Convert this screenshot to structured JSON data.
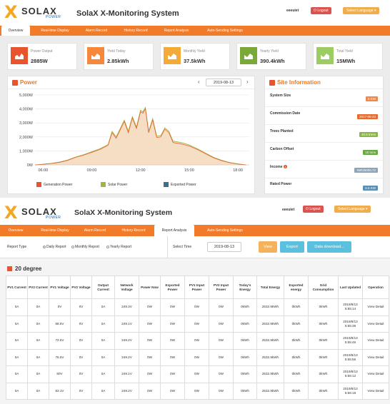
{
  "app": {
    "brand": "SOLAX",
    "brand_sub": "POWER",
    "title": "SolaX X-Monitoring System",
    "user": "eeeuiet",
    "logout_label": "Logout",
    "language_label": "Select Language"
  },
  "tabs": [
    {
      "label": "Overview"
    },
    {
      "label": "Real-time Display"
    },
    {
      "label": "Alarm Record"
    },
    {
      "label": "History Record"
    },
    {
      "label": "Report Analysis"
    },
    {
      "label": "Auto-Sending Settings"
    }
  ],
  "overview": {
    "cards": [
      {
        "label": "Power Output",
        "value": "2885W",
        "color": "#e8542d",
        "icon": "power-chart-icon"
      },
      {
        "label": "Yield Today",
        "value": "2.85kWh",
        "color": "#f5883a",
        "icon": "yield-chart-icon"
      },
      {
        "label": "Monthly Yield",
        "value": "37.5kWh",
        "color": "#f3aa38",
        "icon": "yield-chart-icon"
      },
      {
        "label": "Yearly Yield",
        "value": "390.4kWh",
        "color": "#7ba939",
        "icon": "yield-chart-icon"
      },
      {
        "label": "Total Yield",
        "value": "15MWh",
        "color": "#9ccc62",
        "icon": "yield-chart-icon"
      }
    ],
    "power_panel": {
      "title": "Power",
      "date": "2019-08-13",
      "legend": [
        {
          "label": "Generation Power",
          "color": "#e8542d"
        },
        {
          "label": "Solar Power",
          "color": "#a6b53a"
        },
        {
          "label": "Exported Power",
          "color": "#3b6f8e"
        }
      ]
    },
    "site_info": {
      "title": "Site Information",
      "rows": [
        {
          "label": "System Size",
          "value": "5 KW",
          "color": "#f0874b"
        },
        {
          "label": "Commission Date",
          "value": "2017-05-23",
          "color": "#e96a2d"
        },
        {
          "label": "Trees Planted",
          "value": "40.5 trees",
          "color": "#8ab547"
        },
        {
          "label": "Carbon Offset",
          "value": "15 tons",
          "color": "#6aa842"
        },
        {
          "label": "Income",
          "value": "INR25006.72",
          "color": "#8da3b7"
        },
        {
          "label": "Rated Power",
          "value": "5.5 KW",
          "color": "#5a8fb5"
        }
      ]
    }
  },
  "chart_data": {
    "type": "area",
    "title": "",
    "xlabel": "",
    "ylabel": "",
    "x_ticks": [
      "06:00",
      "09:00",
      "12:00",
      "15:00",
      "18:00"
    ],
    "y_ticks": [
      "0W",
      "1,000W",
      "2,000W",
      "3,000W",
      "4,000W",
      "5,000W"
    ],
    "ylim": [
      0,
      5000
    ],
    "x": [
      5.5,
      6.0,
      6.5,
      7.0,
      7.5,
      8.0,
      8.5,
      9.0,
      9.5,
      10.0,
      10.25,
      10.5,
      10.75,
      11.0,
      11.25,
      11.5,
      11.75,
      12.0,
      12.15,
      12.3,
      12.5,
      12.75,
      13.0,
      13.25,
      13.5,
      13.75,
      14.0,
      14.5,
      15.0,
      15.5,
      16.0,
      16.5,
      17.0,
      17.5,
      18.0,
      18.5
    ],
    "series": [
      {
        "name": "Generation Power",
        "values": [
          0,
          40,
          100,
          180,
          320,
          540,
          700,
          900,
          1100,
          1400,
          2300,
          1900,
          2500,
          3100,
          2300,
          3350,
          2600,
          3800,
          3700,
          4000,
          2300,
          3200,
          1950,
          2000,
          2550,
          2300,
          1600,
          1500,
          1350,
          1100,
          800,
          500,
          300,
          150,
          60,
          0
        ]
      },
      {
        "name": "Solar Power",
        "values": [
          0,
          50,
          110,
          200,
          340,
          560,
          730,
          940,
          1150,
          1450,
          2400,
          2000,
          2600,
          3200,
          2400,
          3450,
          2700,
          3900,
          3800,
          4100,
          2400,
          3300,
          2050,
          2100,
          2650,
          2400,
          1700,
          1600,
          1420,
          1150,
          850,
          540,
          330,
          170,
          70,
          0
        ]
      }
    ]
  },
  "report": {
    "filter": {
      "report_type_label": "Report Type",
      "options": [
        "Daily Report",
        "Monthly Report",
        "Yearly Report"
      ],
      "selected": "Daily Report",
      "select_time_label": "Select Time",
      "date": "2019-08-13",
      "view_label": "View",
      "export_label": "Export",
      "download_label": "Data download..."
    },
    "title": "20 degree",
    "columns": [
      "PV1 Current",
      "PV2 Current",
      "PV1 Voltage",
      "PV2 Voltage",
      "Output Current",
      "Network Voltage",
      "Power Now",
      "Exported Power",
      "PV1 Input Power",
      "PV2 Input Power",
      "Today's Energy",
      "Total Energy",
      "Exported energy",
      "Grid Consumption",
      "Last Updated",
      "Operation"
    ],
    "rows": [
      [
        "0A",
        "0A",
        "0V",
        "0V",
        "0A",
        "249.3V",
        "0W",
        "0W",
        "0W",
        "0W",
        "0kWh",
        "2532.9kWh",
        "0kWh",
        "0kWh",
        "2019/8/13 5:55:14",
        "View Detail"
      ],
      [
        "0A",
        "0A",
        "68.6V",
        "0V",
        "0A",
        "249.1V",
        "0W",
        "0W",
        "0W",
        "0W",
        "0kWh",
        "2532.9kWh",
        "0kWh",
        "0kWh",
        "2019/8/13 5:55:36",
        "View Detail"
      ],
      [
        "0A",
        "0A",
        "72.5V",
        "0V",
        "0A",
        "249.2V",
        "0W",
        "0W",
        "0W",
        "0W",
        "0kWh",
        "2532.9kWh",
        "0kWh",
        "0kWh",
        "2019/8/13 5:55:46",
        "View Detail"
      ],
      [
        "0A",
        "0A",
        "76.5V",
        "0V",
        "0A",
        "249.2V",
        "0W",
        "0W",
        "0W",
        "0W",
        "0kWh",
        "2532.9kWh",
        "0kWh",
        "0kWh",
        "2019/8/13 5:55:56",
        "View Detail"
      ],
      [
        "0A",
        "0A",
        "80V",
        "0V",
        "0A",
        "249.1V",
        "0W",
        "0W",
        "0W",
        "0W",
        "0kWh",
        "2532.9kWh",
        "0kWh",
        "0kWh",
        "2019/8/13 5:56:12",
        "View Detail"
      ],
      [
        "0A",
        "0A",
        "83.1V",
        "0V",
        "0A",
        "249.2V",
        "0W",
        "0W",
        "0W",
        "0W",
        "0kWh",
        "2532.9kWh",
        "0kWh",
        "0kWh",
        "2019/8/13 5:56:18",
        "View Detail"
      ]
    ]
  }
}
